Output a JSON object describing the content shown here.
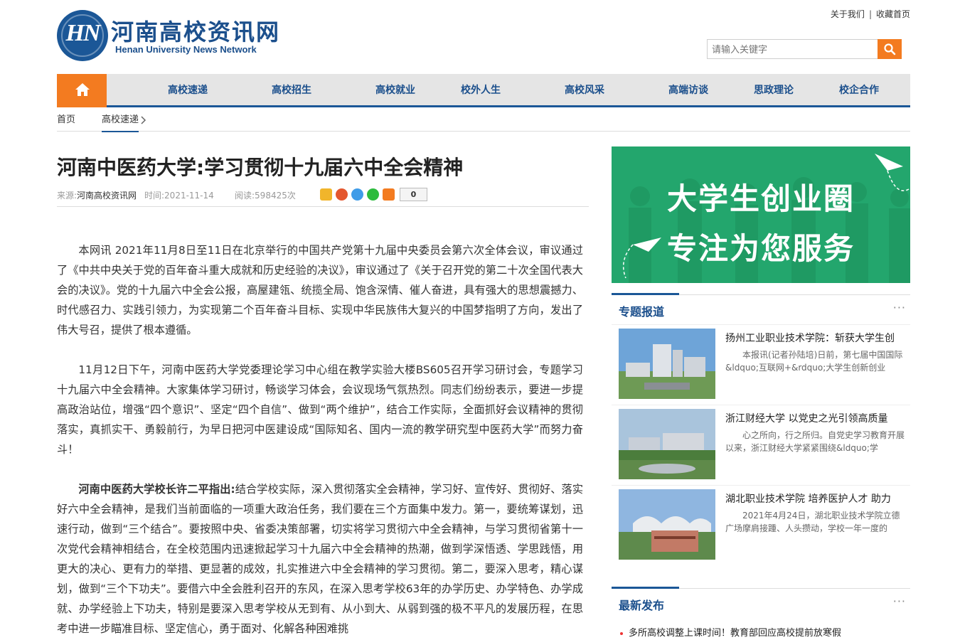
{
  "site": {
    "name_cn": "河南高校资讯网",
    "name_en": "Henan University News Network",
    "logo_mark": "HN",
    "top_links": [
      "关于我们",
      "收藏首页"
    ]
  },
  "search": {
    "placeholder": "请输入关键字",
    "icon": "search-icon"
  },
  "nav": {
    "home_icon": "home-icon",
    "items": [
      "高校速递",
      "高校招生",
      "高校就业",
      "校外人生",
      "高校风采",
      "高端访谈",
      "思政理论",
      "校企合作"
    ]
  },
  "breadcrumb": {
    "home": "首页",
    "current": "高校速递"
  },
  "article": {
    "title": "河南中医药大学:学习贯彻十九届六中全会精神",
    "source_label": "来源:",
    "source": "河南高校资讯网",
    "time_label": "时间:",
    "time": "2021-11-14",
    "views_label": "阅读:",
    "views": "598425次",
    "share_count": "0",
    "paragraphs": [
      "本网讯 2021年11月8日至11日在北京举行的中国共产党第十九届中央委员会第六次全体会议，审议通过了《中共中央关于党的百年奋斗重大成就和历史经验的决议》，审议通过了《关于召开党的第二十次全国代表大会的决议》。党的十九届六中全会公报，高屋建瓴、统揽全局、饱含深情、催人奋进，具有强大的思想震撼力、时代感召力、实践引领力，为实现第二个百年奋斗目标、实现中华民族伟大复兴的中国梦指明了方向，发出了伟大号召，提供了根本遵循。",
      "11月12日下午，河南中医药大学党委理论学习中心组在教学实验大楼BS605召开学习研讨会，专题学习十九届六中全会精神。大家集体学习研讨，畅谈学习体会，会议现场气氛热烈。同志们纷纷表示，要进一步提高政治站位，增强“四个意识”、坚定“四个自信”、做到“两个维护”，结合工作实际，全面抓好会议精神的贯彻落实，真抓实干、勇毅前行，为早日把河中医建设成“国际知名、国内一流的教学研究型中医药大学”而努力奋斗！"
    ],
    "p3_lead": "河南中医药大学校长许二平指出:",
    "p3_text": "结合学校实际，深入贯彻落实全会精神，学习好、宣传好、贯彻好、落实好六中全会精神，是我们当前面临的一项重大政治任务，我们要在三个方面集中发力。第一，要统筹谋划，迅速行动，做到“三个结合”。要按照中央、省委决策部署，切实将学习贯彻六中全会精神，与学习贯彻省第十一次党代会精神相结合，在全校范围内迅速掀起学习十九届六中全会精神的热潮，做到学深悟透、学思践悟，用更大的决心、更有力的举措、更显著的成效，扎实推进六中全会精神的学习贯彻。第二，要深入思考，精心谋划，做到“三个下功夫”。要借六中全会胜利召开的东风，在深入思考学校63年的办学历史、办学特色、办学成就、办学经验上下功夫，特别是要深入思考学校从无到有、从小到大、从弱到强的极不平凡的发展历程，在思考中进一步瞄准目标、坚定信心，勇于面对、化解各种困难挑"
  },
  "sidebar": {
    "banner": {
      "line1": "大学生创业圈",
      "line2": "专注为您服务"
    },
    "special": {
      "heading": "专题报道",
      "more": "···",
      "items": [
        {
          "title": "扬州工业职业技术学院：斩获大学生创",
          "summary": "本报讯(记者孙陆培)日前，第七届中国国际&ldquo;互联网+&rdquo;大学生创新创业"
        },
        {
          "title": "浙江财经大学 以党史之光引领高质量",
          "summary": "心之所向，行之所归。自党史学习教育开展以来，浙江财经大学紧紧围绕&ldquo;学"
        },
        {
          "title": "湖北职业技术学院 培养医护人才 助力",
          "summary": "2021年4月24日，湖北职业技术学院立德广场摩肩接踵、人头攒动，学校一年一度的"
        }
      ]
    },
    "latest": {
      "heading": "最新发布",
      "more": "···",
      "items": [
        "多所高校调整上课时间！教育部回应高校提前放寒假"
      ]
    }
  }
}
